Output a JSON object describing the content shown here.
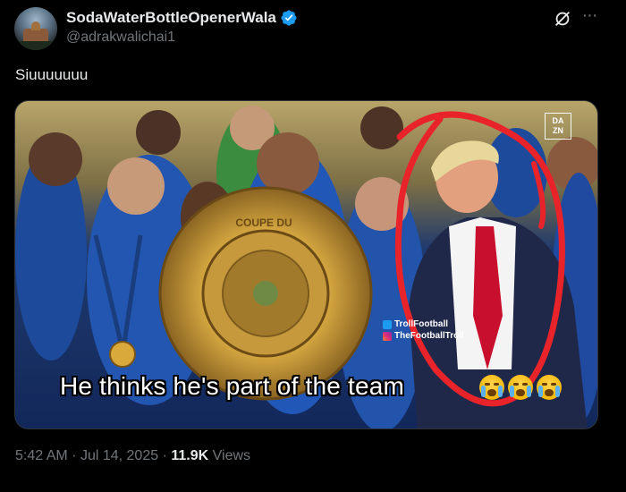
{
  "post": {
    "display_name": "SodaWaterBottleOpenerWala",
    "handle": "@adrakwalichai1",
    "text": "Siuuuuuuu",
    "time": "5:42 AM",
    "separator": "·",
    "date": "Jul 14, 2025",
    "views_count": "11.9K",
    "views_label": "Views"
  },
  "media": {
    "caption": "He thinks he's part of the team",
    "caption_emojis": [
      "loudly-crying-face",
      "loudly-crying-face",
      "loudly-crying-face"
    ],
    "watermark_x": "TrollFootball",
    "watermark_ig": "TheFootballTroll",
    "broadcaster_line1": "DA",
    "broadcaster_line2": "ZN",
    "trophy_text": "COUPE DU"
  },
  "icons": {
    "verified": "verified-badge-icon",
    "grok": "grok-icon",
    "more": "more-icon"
  },
  "colors": {
    "background": "#000000",
    "text_primary": "#e7e9ea",
    "text_secondary": "#71767b",
    "verified": "#1d9bf0",
    "circle_annotation": "#e8242a"
  }
}
